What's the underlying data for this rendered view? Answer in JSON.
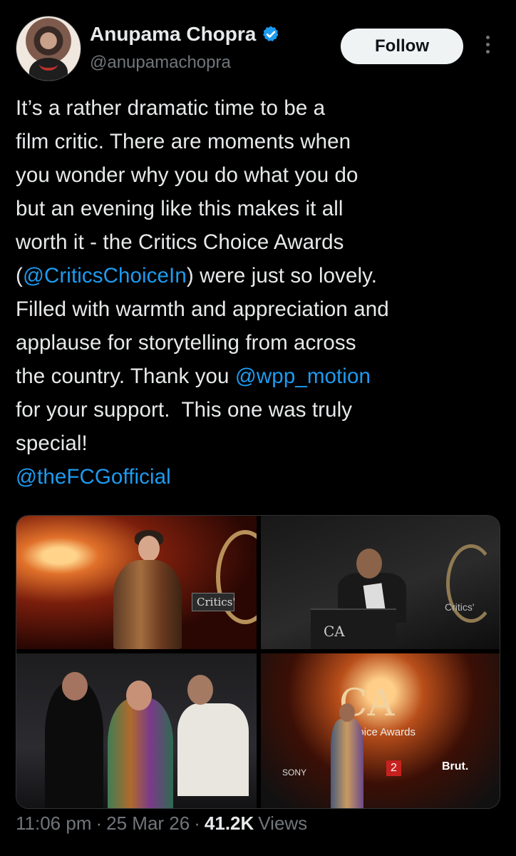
{
  "author": {
    "display_name": "Anupama Chopra",
    "handle": "@anupamachopra",
    "verified": true
  },
  "actions": {
    "follow_label": "Follow",
    "more_icon": "more-vertical-icon"
  },
  "tweet": {
    "segments": [
      {
        "text": "It’s a rather dramatic time to be a\nfilm critic. There are moments when\nyou wonder why you do what you do\nbut an evening like this makes it all\nworth it - the Critics Choice Awards\n(",
        "type": "text"
      },
      {
        "text": "@CriticsChoiceIn",
        "type": "mention"
      },
      {
        "text": ") were just so lovely.\nFilled with warmth and appreciation and\napplause for storytelling from across\nthe country. Thank you ",
        "type": "text"
      },
      {
        "text": "@wpp_motion",
        "type": "mention"
      },
      {
        "text": "\nfor your support.  This one was truly\nspecial!\n",
        "type": "text"
      },
      {
        "text": "@theFCGofficial",
        "type": "mention"
      }
    ]
  },
  "media": {
    "photo_1": {
      "sign_text": "Critics'"
    },
    "photo_2": {
      "podium_text": "CA",
      "side_text": "Critics'"
    },
    "photo_4": {
      "lettering": "CA",
      "awards_text": "hoice Awards",
      "brut": "Brut.",
      "sony": "SONY",
      "channel": "2"
    }
  },
  "meta": {
    "time": "11:06 pm",
    "date": "25 Mar 26",
    "views_count": "41.2K",
    "views_label": "Views",
    "separator": "·"
  },
  "colors": {
    "background": "#000000",
    "text": "#e7e9ea",
    "secondary": "#71767b",
    "mention": "#1d9bf0",
    "verified": "#1d9bf0"
  }
}
